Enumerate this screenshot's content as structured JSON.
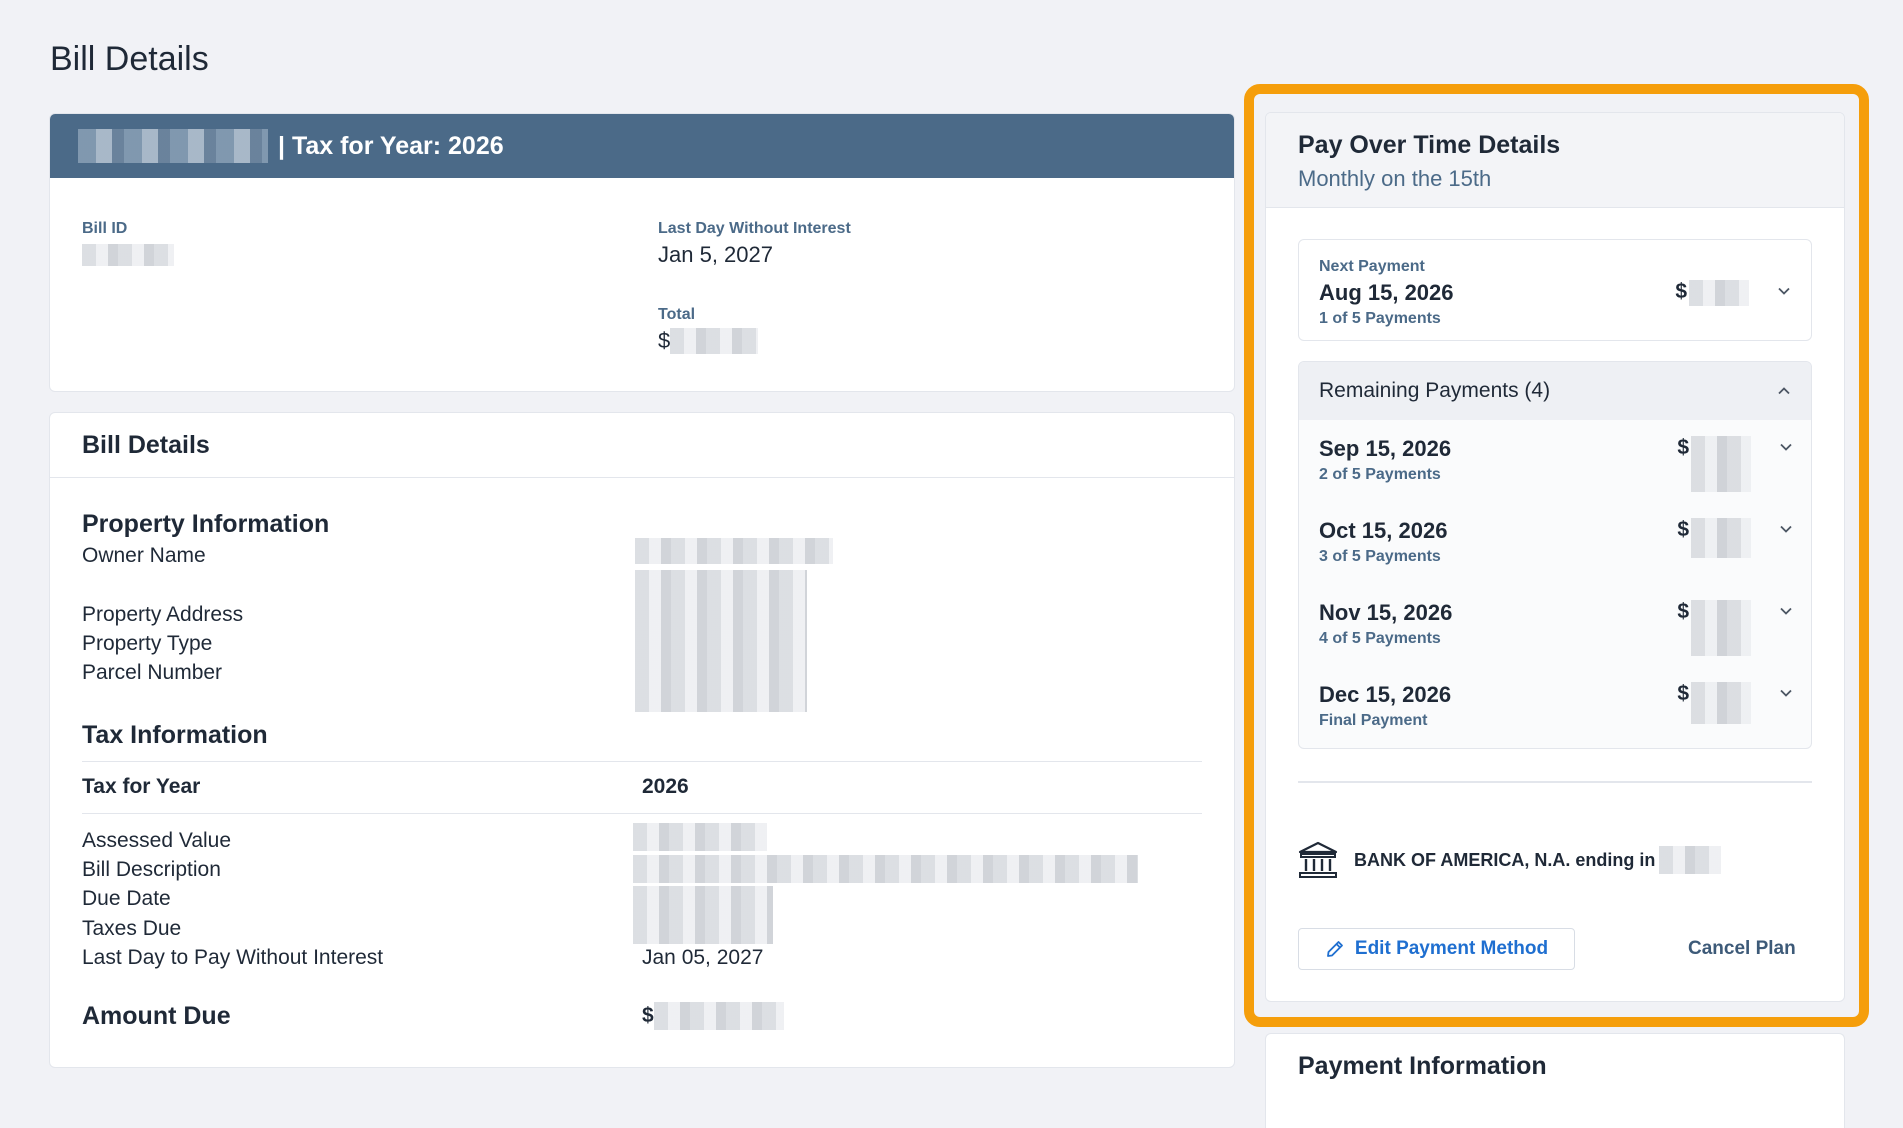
{
  "page": {
    "title": "Bill Details"
  },
  "bill_card": {
    "header_suffix": "| Tax for Year: 2026",
    "bill_id_label": "Bill ID",
    "last_day_label": "Last Day Without Interest",
    "last_day_value": "Jan 5, 2027",
    "total_label": "Total",
    "total_prefix": "$"
  },
  "details_card": {
    "title": "Bill Details",
    "property": {
      "title": "Property Information",
      "owner_label": "Owner Name",
      "address_label": "Property Address",
      "type_label": "Property Type",
      "parcel_label": "Parcel Number"
    },
    "tax": {
      "title": "Tax Information",
      "year_label": "Tax for Year",
      "year_value": "2026",
      "assessed_label": "Assessed Value",
      "description_label": "Bill Description",
      "due_date_label": "Due Date",
      "taxes_due_label": "Taxes Due",
      "last_day_label": "Last Day to Pay Without Interest",
      "last_day_value": "Jan 05, 2027"
    },
    "amount_due_label": "Amount Due",
    "amount_due_prefix": "$"
  },
  "plan": {
    "title": "Pay Over Time Details",
    "subtitle": "Monthly on the 15th",
    "next": {
      "label": "Next Payment",
      "date": "Aug 15, 2026",
      "count": "1 of 5 Payments",
      "amount_prefix": "$"
    },
    "remaining_label": "Remaining Payments (4)",
    "remaining": [
      {
        "date": "Sep 15, 2026",
        "count": "2 of 5 Payments",
        "amount_prefix": "$"
      },
      {
        "date": "Oct 15, 2026",
        "count": "3 of 5 Payments",
        "amount_prefix": "$"
      },
      {
        "date": "Nov 15, 2026",
        "count": "4 of 5 Payments",
        "amount_prefix": "$"
      },
      {
        "date": "Dec 15, 2026",
        "count": "Final Payment",
        "amount_prefix": "$"
      }
    ],
    "bank_text": "BANK OF AMERICA, N.A. ending in",
    "edit_label": "Edit Payment Method",
    "cancel_label": "Cancel Plan"
  },
  "payment_info": {
    "title": "Payment Information"
  },
  "colors": {
    "header": "#4b6a88",
    "highlight": "#f59e0b",
    "link": "#1f6fd0"
  }
}
